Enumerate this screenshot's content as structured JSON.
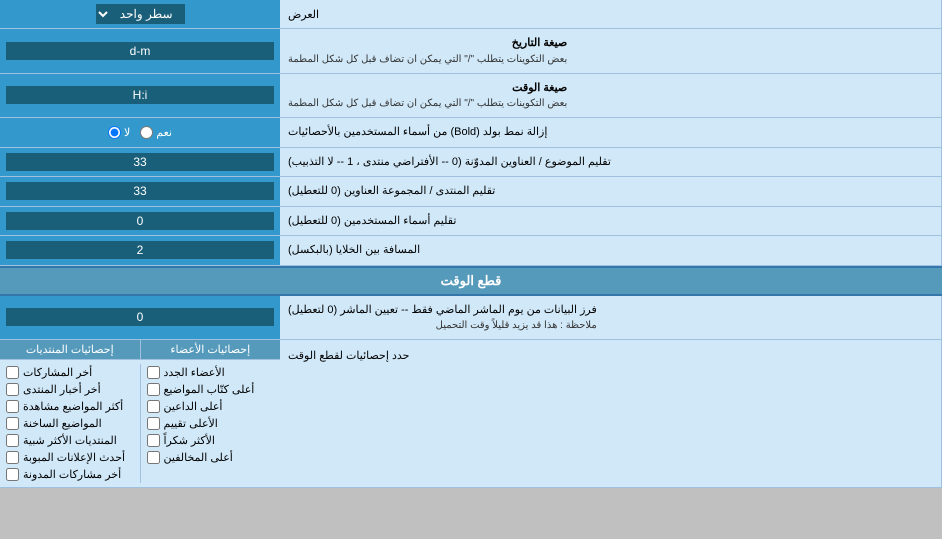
{
  "header": {
    "display_label": "العرض",
    "select_label": "سطر واحد"
  },
  "rows": [
    {
      "id": "date-format",
      "label": "صيغة التاريخ",
      "sublabel": "بعض التكوينات يتطلب \"/\" التي يمكن ان تضاف قبل كل شكل المطمة",
      "value": "d-m",
      "type": "text"
    },
    {
      "id": "time-format",
      "label": "صيغة الوقت",
      "sublabel": "بعض التكوينات يتطلب \"/\" التي يمكن ان تضاف قبل كل شكل المطمة",
      "value": "H:i",
      "type": "text"
    },
    {
      "id": "bold-remove",
      "label": "إزالة نمط بولد (Bold) من أسماء المستخدمين بالأحصائيات",
      "type": "radio",
      "options": [
        {
          "label": "نعم",
          "value": "yes"
        },
        {
          "label": "لا",
          "value": "no",
          "checked": true
        }
      ]
    },
    {
      "id": "subject-align",
      "label": "تقليم الموضوع / العناوين المدوّنة (0 -- الأفتراضي منتدى ، 1 -- لا التذبيب)",
      "value": "33",
      "type": "text"
    },
    {
      "id": "forum-align",
      "label": "تقليم المنتدى / المجموعة العناوين (0 للتعطيل)",
      "value": "33",
      "type": "text"
    },
    {
      "id": "usernames-align",
      "label": "تقليم أسماء المستخدمين (0 للتعطيل)",
      "value": "0",
      "type": "text"
    },
    {
      "id": "spacing",
      "label": "المسافة بين الخلايا (بالبكسل)",
      "value": "2",
      "type": "text"
    }
  ],
  "cutoff_section": {
    "title": "قطع الوقت",
    "row": {
      "label": "فرز البيانات من يوم الماشر الماضي فقط -- تعيين الماشر (0 لتعطيل)",
      "sublabel": "ملاحظة : هذا قد يزيد قليلاً وقت التحميل",
      "value": "0"
    },
    "limit_label": "حدد إحصائيات لقطع الوقت"
  },
  "checkboxes": {
    "col1_header": "إحصائيات المنتديات",
    "col2_header": "إحصائيات الأعضاء",
    "col1_items": [
      "أخر المشاركات",
      "أخر أخبار المنتدى",
      "أكثر المواضيع مشاهدة",
      "المواضيع الساخنة",
      "المنتديات الأكثر شبية",
      "أحدث الإعلانات المبوبة",
      "أخر مشاركات المدونة"
    ],
    "col2_items": [
      "الأعضاء الجدد",
      "أعلى كتّاب المواضيع",
      "أعلى الداعين",
      "الأعلى تقييم",
      "الأكثر شكراً",
      "أعلى المخالفين"
    ]
  }
}
